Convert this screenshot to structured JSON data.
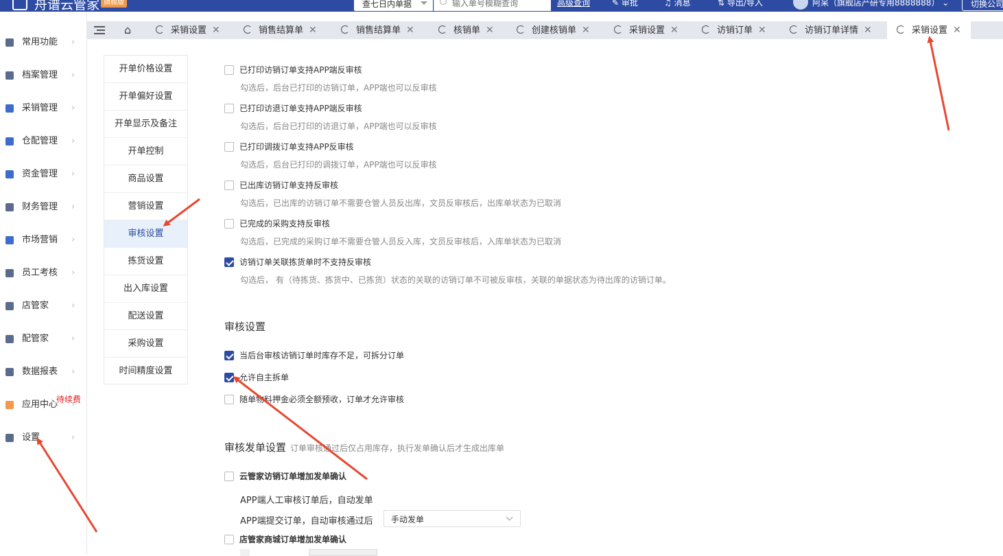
{
  "header": {
    "brand": "舟谱云管家",
    "edition": "旗舰版",
    "filter_value": "查七日内单据",
    "search_placeholder": "输入单号模糊查询",
    "advanced_search": "高级查询",
    "approve": "审批",
    "messages": "消息",
    "import_export": "导出/导入",
    "user": "阿呆（旗舰店产研专用8888888）",
    "switch_company": "切换公司"
  },
  "sidebar": {
    "items": [
      {
        "label": "常用功能",
        "color": "#5b6b8c"
      },
      {
        "label": "档案管理",
        "color": "#5b6b8c"
      },
      {
        "label": "采销管理",
        "color": "#3d6ccf"
      },
      {
        "label": "仓配管理",
        "color": "#3d6ccf"
      },
      {
        "label": "资金管理",
        "color": "#3d6ccf"
      },
      {
        "label": "财务管理",
        "color": "#5b6b8c"
      },
      {
        "label": "市场营销",
        "color": "#3d6ccf"
      },
      {
        "label": "员工考核",
        "color": "#5b6b8c"
      },
      {
        "label": "店管家",
        "color": "#5b6b8c"
      },
      {
        "label": "配管家",
        "color": "#5b6b8c"
      },
      {
        "label": "数据报表",
        "color": "#5b6b8c"
      },
      {
        "label": "应用中心",
        "color": "#f2994a"
      },
      {
        "label": "设置",
        "color": "#5b6b8c"
      }
    ],
    "due_badge": "待续费"
  },
  "tabs": [
    {
      "label": "采销设置"
    },
    {
      "label": "销售结算单"
    },
    {
      "label": "销售结算单"
    },
    {
      "label": "核销单"
    },
    {
      "label": "创建核销单"
    },
    {
      "label": "采销设置"
    },
    {
      "label": "访销订单"
    },
    {
      "label": "访销订单详情"
    },
    {
      "label": "采销设置"
    }
  ],
  "submenu": [
    "开单价格设置",
    "开单偏好设置",
    "开单显示及备注",
    "开单控制",
    "商品设置",
    "营销设置",
    "审核设置",
    "拣货设置",
    "出入库设置",
    "配送设置",
    "采购设置",
    "时间精度设置"
  ],
  "options_top": [
    {
      "label": "已打印访销订单支持APP端反审核",
      "desc": "勾选后，后台已打印的访销订单，APP端也可以反审核",
      "checked": false
    },
    {
      "label": "已打印访退订单支持APP端反审核",
      "desc": "勾选后，后台已打印的访退订单，APP端也可以反审核",
      "checked": false
    },
    {
      "label": "已打印调拨订单支持APP反审核",
      "desc": "勾选后，后台已打印的调拨订单，APP端也可以反审核",
      "checked": false
    },
    {
      "label": "已出库访销订单支持反审核",
      "desc": "勾选后，已出库的访销订单不需要仓管人员反出库，文员反审核后，出库单状态为已取消",
      "checked": false
    },
    {
      "label": "已完成的采购支持反审核",
      "desc": "勾选后，已完成的采购订单不需要仓管人员反入库，文员反审核后，入库单状态为已取消",
      "checked": false
    },
    {
      "label": "访销订单关联拣货单时不支持反审核",
      "desc": "勾选后， 有（待拣货、拣货中、已拣货）状态的关联的访销订单不可被反审核，关联的单据状态为待出库的访销订单。",
      "checked": true
    }
  ],
  "audit": {
    "title": "审核设置",
    "options": [
      {
        "label": "当后台审核访销订单时库存不足，可拆分订单",
        "checked": true
      },
      {
        "label": "允许自主拆单",
        "checked": true
      },
      {
        "label": "随单物料押金必须全额预收，订单才允许审核",
        "checked": false
      }
    ]
  },
  "dispatch": {
    "title": "审核发单设置",
    "subtitle": "订单审核通过后仅占用库存，执行发单确认后才生成出库单",
    "option1": "云管家访销订单增加发单确认",
    "line1": "APP端人工审核订单后，自动发单",
    "line2": "APP端提交订单，自动审核通过后",
    "select_value": "手动发单",
    "option2": "店管家商城订单增加发单确认"
  },
  "colors": {
    "primary": "#2d4ba3",
    "arrow": "#e8462f"
  }
}
